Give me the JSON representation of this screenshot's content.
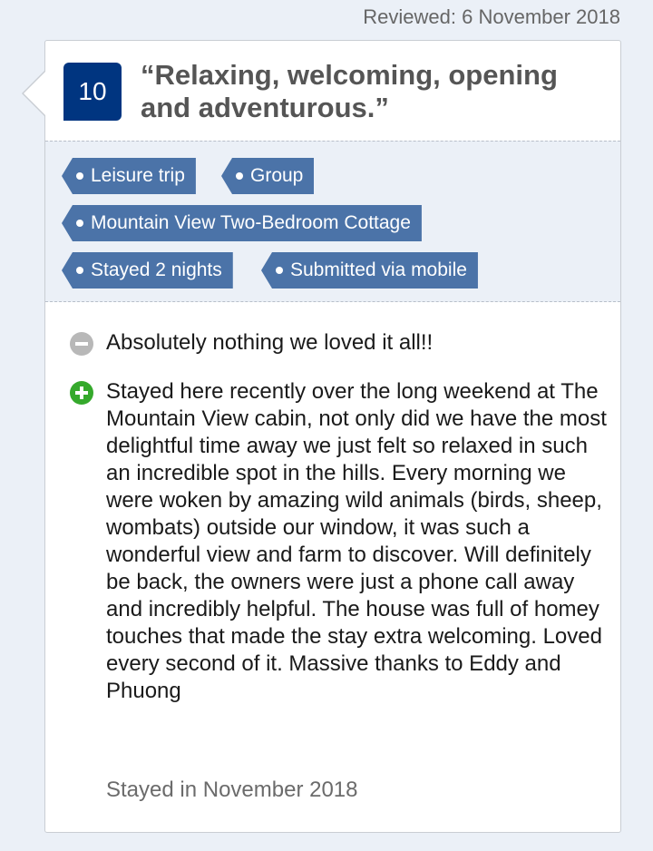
{
  "review": {
    "date_label": "Reviewed: 6 November 2018",
    "score": "10",
    "title": "“Relaxing, welcoming, opening and adventurous.”",
    "tags": [
      "Leisure trip",
      "Group",
      "Mountain View Two-Bedroom Cottage",
      "Stayed 2 nights",
      "Submitted via mobile"
    ],
    "negative": "Absolutely nothing we loved it all!!",
    "positive": "Stayed here recently over the long weekend at The Mountain View cabin, not only did we have the most delightful time away we just felt so relaxed in such an incredible spot in the hills. Every morning we were woken by amazing wild animals (birds, sheep, wombats) outside our window, it was such a wonderful view and farm to discover. Will definitely be back, the owners were just a phone call away and incredibly helpful. The house was full of homey touches that made the stay extra welcoming. Loved every second of it. Massive thanks to Eddy and Phuong",
    "stayed_in": "Stayed in November 2018"
  },
  "colors": {
    "score_bg": "#003580",
    "tag_bg": "#4b73a8",
    "positive_icon": "#35a92c",
    "negative_icon": "#b8b8b8",
    "page_bg": "#ebf0f7"
  },
  "icons": {
    "negative": "minus-circle-icon",
    "positive": "plus-circle-icon"
  }
}
